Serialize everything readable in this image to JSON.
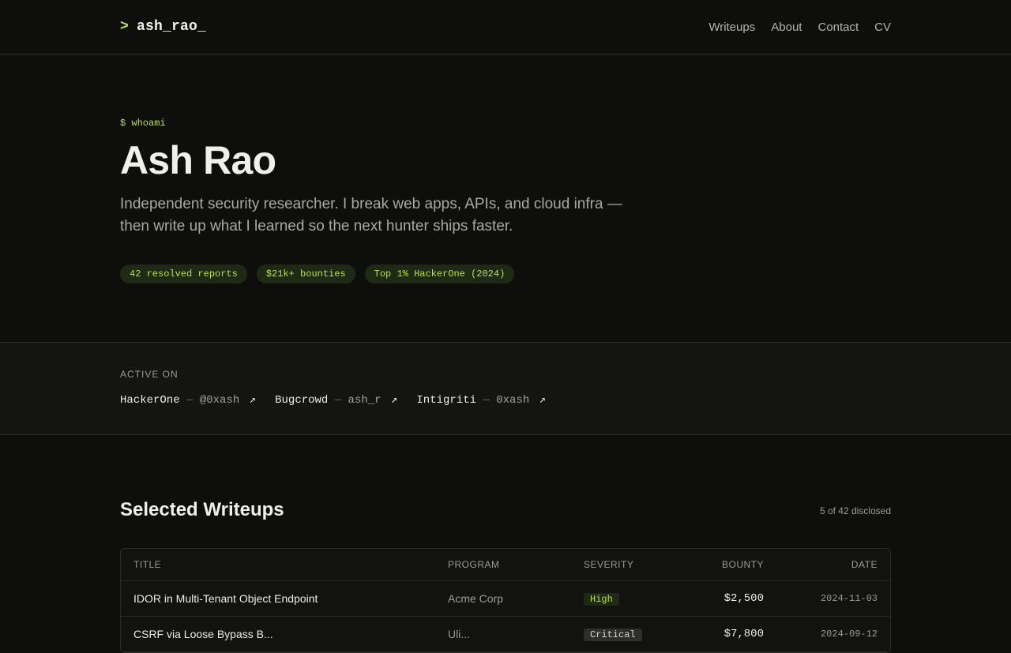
{
  "header": {
    "prompt": ">",
    "logo": "ash_rao_",
    "nav": [
      "Writeups",
      "About",
      "Contact",
      "CV"
    ]
  },
  "hero": {
    "command": "$ whoami",
    "name": "Ash Rao",
    "bio": "Independent security researcher. I break web apps, APIs, and cloud infra — then write up what I learned so the next hunter ships faster.",
    "pills": [
      "42 resolved reports",
      "$21k+ bounties",
      "Top 1% HackerOne (2024)"
    ]
  },
  "active_on": {
    "label": "ACTIVE ON",
    "platforms": [
      {
        "name": "HackerOne",
        "handle": "@0xash"
      },
      {
        "name": "Bugcrowd",
        "handle": "ash_r"
      },
      {
        "name": "Intigriti",
        "handle": "0xash"
      }
    ],
    "separator": "—",
    "arrow": "↗"
  },
  "writeups": {
    "title": "Selected Writeups",
    "count": "5 of 42 disclosed",
    "columns": [
      "TITLE",
      "PROGRAM",
      "SEVERITY",
      "BOUNTY",
      "DATE"
    ],
    "rows": [
      {
        "title": "IDOR in Multi-Tenant Object Endpoint",
        "program": "Acme Corp",
        "severity": "High",
        "bounty": "$2,500",
        "date": "2024-11-03"
      },
      {
        "title": "CSRF via Loose Bypass B...",
        "program": "Uli...",
        "severity": "Critical",
        "bounty": "$7,800",
        "date": "2024-09-12"
      }
    ]
  },
  "colors": {
    "background": "#0e0f0d",
    "accent": "#b8e04a",
    "pill_bg": "#1f2a14"
  }
}
